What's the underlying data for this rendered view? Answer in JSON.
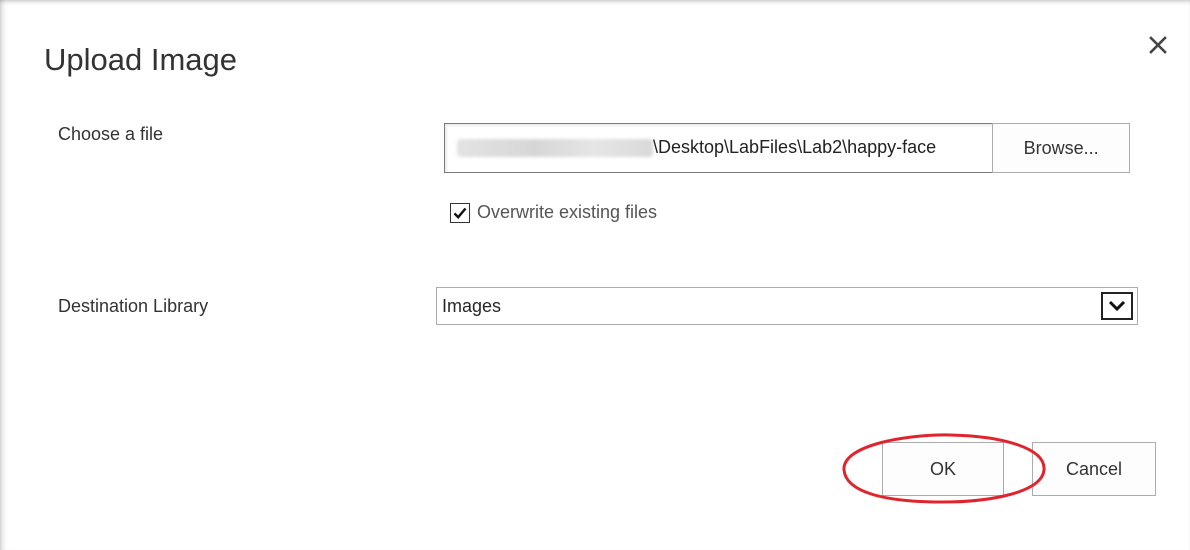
{
  "dialog": {
    "title": "Upload Image",
    "close_glyph": "×"
  },
  "file": {
    "label": "Choose a file",
    "path_visible": "\\Desktop\\LabFiles\\Lab2\\happy-face",
    "browse_label": "Browse..."
  },
  "overwrite": {
    "label": "Overwrite existing files",
    "checked": true
  },
  "destination": {
    "label": "Destination Library",
    "selected": "Images"
  },
  "actions": {
    "ok_label": "OK",
    "cancel_label": "Cancel"
  },
  "annotation": {
    "color": "#e0242e",
    "shape": "ellipse around OK button"
  }
}
